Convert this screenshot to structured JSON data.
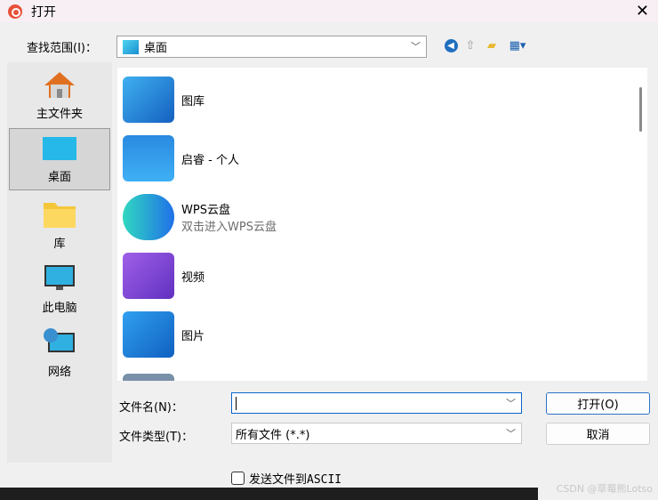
{
  "window": {
    "title": "打开",
    "close": "✕"
  },
  "look_in": {
    "label": "查找范围(I)：",
    "value": "桌面"
  },
  "toolbar": {
    "icons": [
      "back-icon",
      "up-folder-icon",
      "new-folder-icon",
      "view-menu-icon"
    ]
  },
  "sidebar": {
    "items": [
      {
        "label": "主文件夹"
      },
      {
        "label": "桌面",
        "selected": true
      },
      {
        "label": "库"
      },
      {
        "label": "此电脑"
      },
      {
        "label": "网络"
      }
    ]
  },
  "files": [
    {
      "name": "图库",
      "sub": ""
    },
    {
      "name": "启睿 - 个人",
      "sub": ""
    },
    {
      "name": "WPS云盘",
      "sub": "双击进入WPS云盘"
    },
    {
      "name": "视频",
      "sub": ""
    },
    {
      "name": "图片",
      "sub": ""
    }
  ],
  "filename": {
    "label": "文件名(N)：",
    "value": ""
  },
  "filetype": {
    "label": "文件类型(T)：",
    "value": "所有文件 (*.*)"
  },
  "buttons": {
    "open": "打开(O)",
    "cancel": "取消"
  },
  "checkbox": {
    "label": "发送文件到ASCII",
    "checked": false
  },
  "watermark": "CSDN @草莓熊Lotso"
}
